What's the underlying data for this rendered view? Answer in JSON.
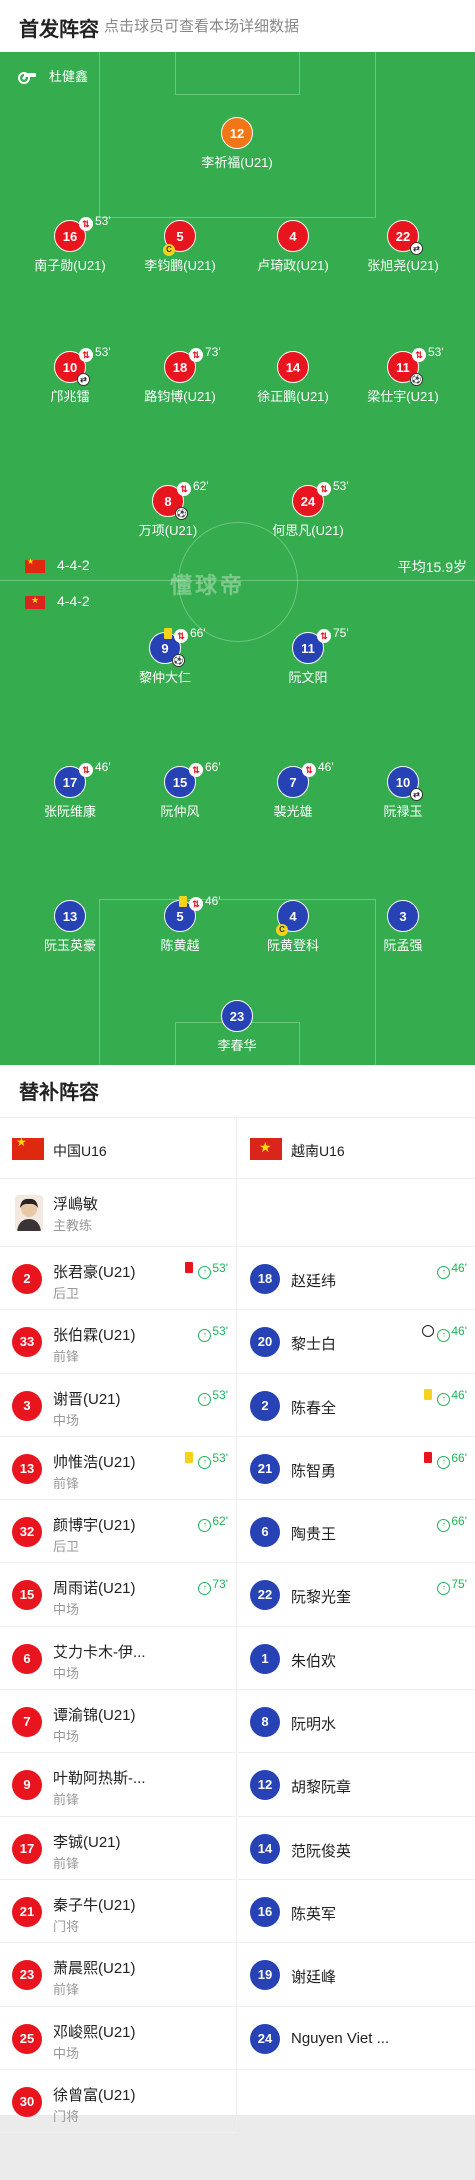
{
  "header": {
    "title": "首发阵容",
    "subtitle": "点击球员可查看本场详细数据"
  },
  "referee": "杜健鑫",
  "watermark": "懂球帝",
  "home": {
    "formation": "4-4-2",
    "average_age": "平均15.9岁",
    "players": [
      {
        "num": "12",
        "name": "李祈福(U21)",
        "color": "ora"
      },
      {
        "num": "16",
        "name": "南子勋(U21)",
        "sub": "53'"
      },
      {
        "num": "5",
        "name": "李钧鹏(U21)",
        "captain": true
      },
      {
        "num": "4",
        "name": "卢琦政(U21)"
      },
      {
        "num": "22",
        "name": "张旭尧(U21)",
        "in": true
      },
      {
        "num": "10",
        "name": "邝兆镭",
        "sub": "53'",
        "in": true
      },
      {
        "num": "18",
        "name": "路钧博(U21)",
        "sub": "73'"
      },
      {
        "num": "14",
        "name": "徐正鹏(U21)"
      },
      {
        "num": "11",
        "name": "梁仕宇(U21)",
        "sub": "53'",
        "goal": true
      },
      {
        "num": "8",
        "name": "万项(U21)",
        "sub": "62'",
        "goal": true
      },
      {
        "num": "24",
        "name": "何思凡(U21)",
        "sub": "53'"
      }
    ]
  },
  "away": {
    "formation": "4-4-2",
    "players": [
      {
        "num": "9",
        "name": "黎仲大仁",
        "sub": "66'",
        "goal": true,
        "yellow": true
      },
      {
        "num": "11",
        "name": "阮文阳",
        "sub": "75'"
      },
      {
        "num": "17",
        "name": "张阮维康",
        "sub": "46'"
      },
      {
        "num": "15",
        "name": "阮仲风",
        "sub": "66'"
      },
      {
        "num": "7",
        "name": "裴光雄",
        "sub": "46'"
      },
      {
        "num": "10",
        "name": "阮禄玉",
        "in": true
      },
      {
        "num": "13",
        "name": "阮玉英豪"
      },
      {
        "num": "5",
        "name": "陈黄越",
        "sub": "46'",
        "yellow": true
      },
      {
        "num": "4",
        "name": "阮黄登科",
        "captain": true
      },
      {
        "num": "3",
        "name": "阮孟强"
      },
      {
        "num": "23",
        "name": "李春华"
      }
    ]
  },
  "bench": {
    "title": "替补阵容",
    "home_team": "中国U16",
    "away_team": "越南U16",
    "coach": {
      "name": "浮嶋敏",
      "role": "主教练"
    },
    "home": [
      {
        "num": "2",
        "name": "张君豪(U21)",
        "pos": "后卫",
        "red": true,
        "sub": "53'"
      },
      {
        "num": "33",
        "name": "张伯霖(U21)",
        "pos": "前锋",
        "sub": "53'"
      },
      {
        "num": "3",
        "name": "谢晋(U21)",
        "pos": "中场",
        "sub": "53'"
      },
      {
        "num": "13",
        "name": "帅惟浩(U21)",
        "pos": "前锋",
        "yellow": true,
        "sub": "53'"
      },
      {
        "num": "32",
        "name": "颜博宇(U21)",
        "pos": "后卫",
        "sub": "62'"
      },
      {
        "num": "15",
        "name": "周雨诺(U21)",
        "pos": "中场",
        "sub": "73'"
      },
      {
        "num": "6",
        "name": "艾力卡木-伊...",
        "pos": "中场"
      },
      {
        "num": "7",
        "name": "谭渝锦(U21)",
        "pos": "中场"
      },
      {
        "num": "9",
        "name": "叶勒阿热斯-...",
        "pos": "前锋"
      },
      {
        "num": "17",
        "name": "李铖(U21)",
        "pos": "前锋"
      },
      {
        "num": "21",
        "name": "秦子牛(U21)",
        "pos": "门将"
      },
      {
        "num": "23",
        "name": "萧晨熙(U21)",
        "pos": "前锋"
      },
      {
        "num": "25",
        "name": "邓峻熙(U21)",
        "pos": "中场"
      },
      {
        "num": "30",
        "name": "徐曾富(U21)",
        "pos": "门将"
      }
    ],
    "away": [
      {
        "num": "18",
        "name": "赵廷纬",
        "sub": "46'"
      },
      {
        "num": "20",
        "name": "黎士白",
        "ball": true,
        "sub": "46'"
      },
      {
        "num": "2",
        "name": "陈春全",
        "yellow": true,
        "sub": "46'"
      },
      {
        "num": "21",
        "name": "陈智勇",
        "red": true,
        "sub": "66'"
      },
      {
        "num": "6",
        "name": "陶贵王",
        "sub": "66'"
      },
      {
        "num": "22",
        "name": "阮黎光奎",
        "sub": "75'"
      },
      {
        "num": "1",
        "name": "朱伯欢"
      },
      {
        "num": "8",
        "name": "阮明水"
      },
      {
        "num": "12",
        "name": "胡黎阮章"
      },
      {
        "num": "14",
        "name": "范阮俊英"
      },
      {
        "num": "16",
        "name": "陈英军"
      },
      {
        "num": "19",
        "name": "谢廷峰"
      },
      {
        "num": "24",
        "name": "Nguyen Viet ..."
      }
    ]
  }
}
